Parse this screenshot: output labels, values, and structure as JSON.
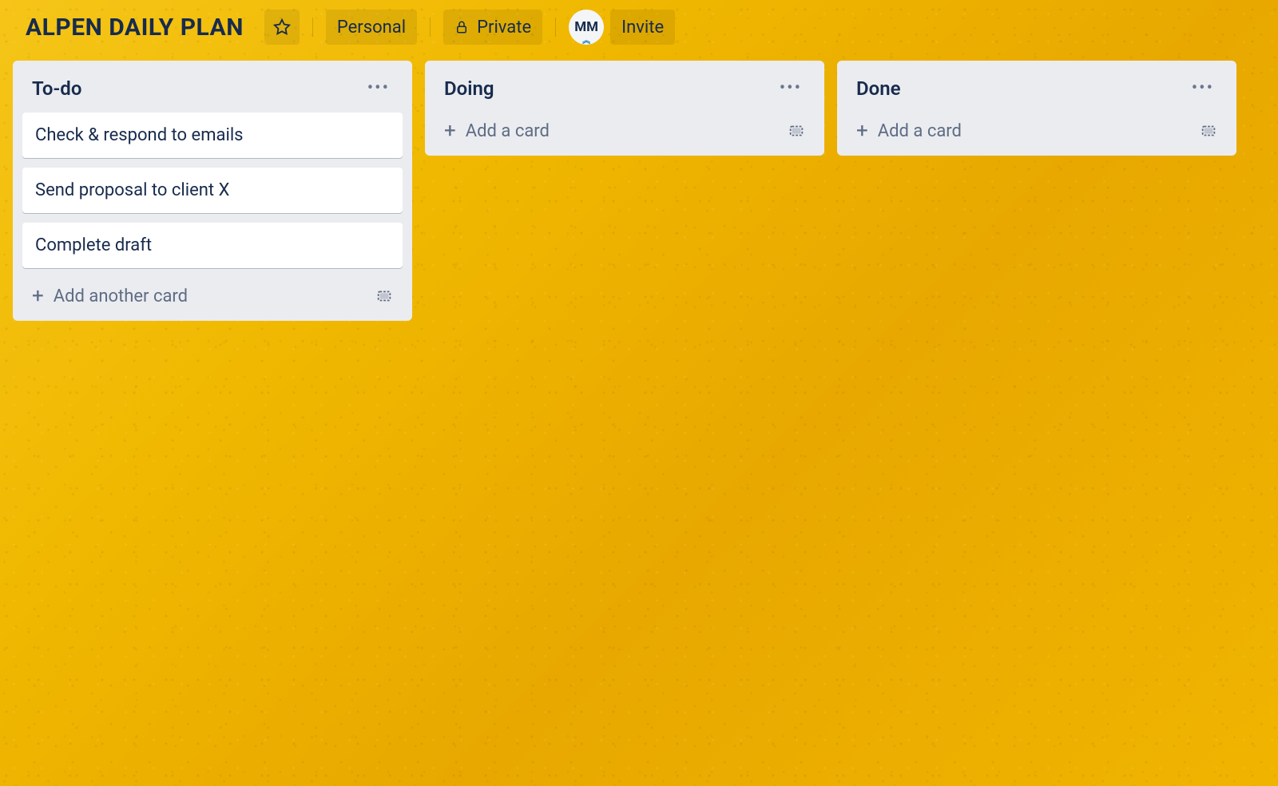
{
  "header": {
    "board_title": "ALPEN DAILY PLAN",
    "workspace_label": "Personal",
    "visibility_label": "Private",
    "avatar_initials": "MM",
    "invite_label": "Invite"
  },
  "lists": [
    {
      "title": "To-do",
      "cards": [
        "Check & respond to emails",
        "Send proposal to client X",
        "Complete draft"
      ],
      "add_label": "Add another card"
    },
    {
      "title": "Doing",
      "cards": [],
      "add_label": "Add a card"
    },
    {
      "title": "Done",
      "cards": [],
      "add_label": "Add a card"
    }
  ]
}
